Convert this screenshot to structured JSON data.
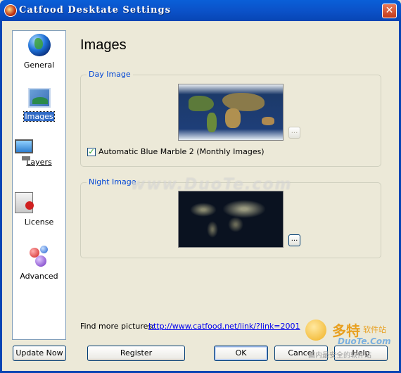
{
  "window": {
    "title": "Catfood Desktate Settings",
    "close_glyph": "✕"
  },
  "sidebar": {
    "items": [
      {
        "label": "General",
        "icon": "globe-icon",
        "active": false
      },
      {
        "label": "Images",
        "icon": "picture-icon",
        "active": true
      },
      {
        "label": "Layers",
        "icon": "monitor-icon",
        "active": false
      },
      {
        "label": "License",
        "icon": "certificate-icon",
        "active": false
      },
      {
        "label": "Advanced",
        "icon": "molecule-icon",
        "active": false
      }
    ]
  },
  "main": {
    "page_title": "Images",
    "day_image": {
      "legend": "Day Image",
      "browse_label": "...",
      "checkbox_checked": true,
      "checkbox_label": "Automatic Blue Marble 2 (Monthly Images)"
    },
    "night_image": {
      "legend": "Night Image",
      "browse_label": "..."
    },
    "find_more_label": "Find more pictures:",
    "find_more_link": "http://www.catfood.net/link/?link=2001"
  },
  "buttons": {
    "update_now": "Update Now",
    "register": "Register",
    "ok": "OK",
    "cancel": "Cancel",
    "help": "Help"
  },
  "watermark": {
    "site": "www.DuoTe.com",
    "logo_big": "多特",
    "logo_small": "软件站",
    "logo_mid": "DuoTe.Com",
    "logo_foot": "国内最安全的软件站"
  },
  "colors": {
    "titlebar": "#0a5fd8",
    "legend": "#0046d5",
    "link": "#0000ee",
    "selection": "#316ac5"
  }
}
